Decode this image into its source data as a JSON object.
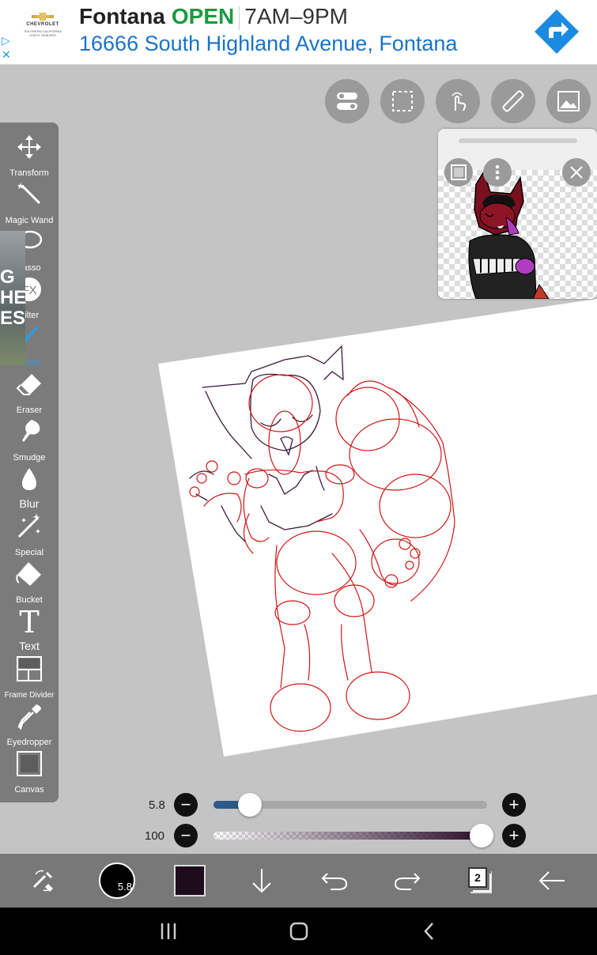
{
  "ad": {
    "brand_logo_text": "CHEVROLET",
    "dealer_text": "SOUTHERN CALIFORNIA CHEVY DEALERS",
    "business_name": "Fontana",
    "status": "OPEN",
    "hours": "7AM–9PM",
    "address": "16666 South Highland Avenue, Fontana",
    "choices_icon": "ad-choices-icon",
    "close_icon": "✕",
    "directions_icon": "directions-icon",
    "colors": {
      "open": "#1b9a3f",
      "address": "#1a73c8",
      "directions": "#1a8be0"
    }
  },
  "top_tools": [
    {
      "name": "toggle-icon"
    },
    {
      "name": "selection-icon"
    },
    {
      "name": "touch-icon"
    },
    {
      "name": "ruler-icon"
    },
    {
      "name": "reference-image-icon"
    }
  ],
  "toolbar": {
    "tools": [
      {
        "id": "transform",
        "label": "Transform",
        "icon": "move-arrows-icon"
      },
      {
        "id": "magic-wand",
        "label": "Magic Wand",
        "icon": "magic-wand-icon"
      },
      {
        "id": "lasso",
        "label": "Lasso",
        "icon": "lasso-icon"
      },
      {
        "id": "filter",
        "label": "Filter",
        "icon": "fx-icon"
      },
      {
        "id": "brush",
        "label": "Brush",
        "icon": "brush-icon",
        "active": true
      },
      {
        "id": "eraser",
        "label": "Eraser",
        "icon": "eraser-icon"
      },
      {
        "id": "smudge",
        "label": "Smudge",
        "icon": "smudge-icon"
      },
      {
        "id": "blur",
        "label": "Blur",
        "icon": "blur-drop-icon"
      },
      {
        "id": "special",
        "label": "Special",
        "icon": "special-sparkle-icon"
      },
      {
        "id": "bucket",
        "label": "Bucket",
        "icon": "bucket-icon"
      },
      {
        "id": "text",
        "label": "Text",
        "icon": "text-icon"
      },
      {
        "id": "frame-divider",
        "label": "Frame Divider",
        "icon": "frame-divider-icon"
      },
      {
        "id": "eyedropper",
        "label": "Eyedropper",
        "icon": "eyedropper-icon"
      },
      {
        "id": "canvas",
        "label": "Canvas",
        "icon": "canvas-icon"
      }
    ],
    "overlay_letters": [
      "G",
      "HE",
      "ES"
    ]
  },
  "reference_window": {
    "thumbnail_icon": "reference-thumbnail-icon",
    "menu_icon": "more-vertical-icon",
    "close_icon": "close-icon"
  },
  "brush_size": {
    "label": "5.8",
    "value": 5.8,
    "fraction": 0.09
  },
  "opacity": {
    "label": "100",
    "value": 100,
    "fraction": 1.0
  },
  "bottom_bar": {
    "brush_size_text": "5.8",
    "color_hex": "#1e0b1c",
    "layer_count": "2",
    "colors": {
      "bar": "#787878"
    }
  }
}
